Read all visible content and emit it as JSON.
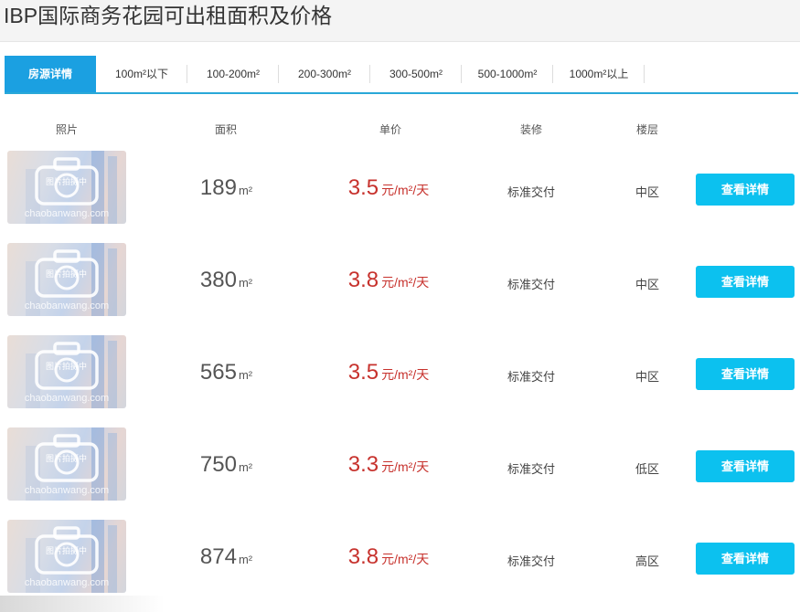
{
  "header": {
    "title": "IBP国际商务花园可出租面积及价格"
  },
  "tabs": [
    {
      "label": "房源详情",
      "active": true
    },
    {
      "label": "100m²以下",
      "active": false
    },
    {
      "label": "100-200m²",
      "active": false
    },
    {
      "label": "200-300m²",
      "active": false
    },
    {
      "label": "300-500m²",
      "active": false
    },
    {
      "label": "500-1000m²",
      "active": false
    },
    {
      "label": "1000m²以上",
      "active": false
    }
  ],
  "columns": {
    "photo": "照片",
    "area": "面积",
    "unit_price": "单价",
    "decoration": "装修",
    "floor": "楼层"
  },
  "thumbnail": {
    "watermark_text": "图片拍摄中",
    "watermark_site": "chaobanwang.com"
  },
  "listings": [
    {
      "area": "189",
      "area_unit": "m²",
      "price": "3.5",
      "price_unit": "元/m²/天",
      "decoration": "标准交付",
      "floor": "中区",
      "button": "查看详情"
    },
    {
      "area": "380",
      "area_unit": "m²",
      "price": "3.8",
      "price_unit": "元/m²/天",
      "decoration": "标准交付",
      "floor": "中区",
      "button": "查看详情"
    },
    {
      "area": "565",
      "area_unit": "m²",
      "price": "3.5",
      "price_unit": "元/m²/天",
      "decoration": "标准交付",
      "floor": "中区",
      "button": "查看详情"
    },
    {
      "area": "750",
      "area_unit": "m²",
      "price": "3.3",
      "price_unit": "元/m²/天",
      "decoration": "标准交付",
      "floor": "低区",
      "button": "查看详情"
    },
    {
      "area": "874",
      "area_unit": "m²",
      "price": "3.8",
      "price_unit": "元/m²/天",
      "decoration": "标准交付",
      "floor": "高区",
      "button": "查看详情"
    }
  ],
  "colors": {
    "tab_active_bg": "#1ba0e1",
    "tab_underline": "#29a8d8",
    "price": "#c7322d",
    "button_bg": "#0cc1ef"
  }
}
